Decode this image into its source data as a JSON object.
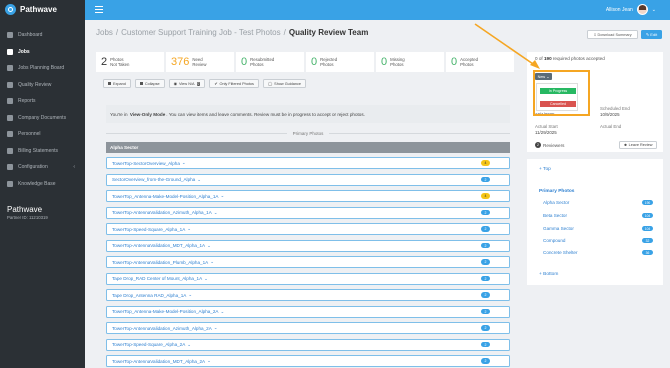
{
  "app": {
    "name": "Pathwave",
    "partner_id": "Partner ID: 11210319"
  },
  "sidebar": {
    "items": [
      {
        "label": "Dashboard",
        "icon": "dashboard-icon"
      },
      {
        "label": "Jobs",
        "icon": "tools-icon",
        "active": true
      },
      {
        "label": "Jobs Planning Board",
        "icon": "board-icon"
      },
      {
        "label": "Quality Review",
        "icon": "review-icon"
      },
      {
        "label": "Reports",
        "icon": "reports-icon"
      },
      {
        "label": "Company Documents",
        "icon": "documents-icon"
      },
      {
        "label": "Personnel",
        "icon": "people-icon"
      },
      {
        "label": "Billing Statements",
        "icon": "billing-icon"
      },
      {
        "label": "Configuration",
        "icon": "gear-icon",
        "caret": "‹"
      },
      {
        "label": "Knowledge Base",
        "icon": "help-icon"
      }
    ]
  },
  "topbar": {
    "user_name": "Allison Jean"
  },
  "breadcrumb": {
    "jobs": "Jobs",
    "job": "Customer Support Training Job - Test Photos",
    "current": "Quality Review Team"
  },
  "header_buttons": {
    "download": "Download Summary",
    "edit": "Edit"
  },
  "stats": [
    {
      "num": "2",
      "label1": "Photos",
      "label2": "Not Taken",
      "color": "default"
    },
    {
      "num": "376",
      "label1": "Need",
      "label2": "Review",
      "color": "orange"
    },
    {
      "num": "0",
      "label1": "Resubmitted",
      "label2": "Photos",
      "color": "green"
    },
    {
      "num": "0",
      "label1": "Rejected",
      "label2": "Photos",
      "color": "green"
    },
    {
      "num": "0",
      "label1": "Missing",
      "label2": "Photos",
      "color": "green"
    },
    {
      "num": "0",
      "label1": "Accepted",
      "label2": "Photos",
      "color": "green"
    }
  ],
  "toolbar": {
    "expand": "Expand",
    "collapse": "Collapse",
    "view_na": "View N/A",
    "view_na_badge": "0",
    "filtered": "Only Filtered Photos",
    "guidance": "Show Guidance"
  },
  "notice": {
    "pre": "You're in",
    "mode": "View-Only Mode",
    "post": ". You can view items and leave comments. Review must be in progress to accept or reject photos."
  },
  "primary_photos_label": "Primary Photos",
  "sector_header": "Alpha Sector",
  "rows": [
    {
      "label": "TowerTop-SectorOverview_Alpha",
      "count": "4",
      "color": "yellow"
    },
    {
      "label": "SectorOverview_from-the-Ground_Alpha",
      "count": "2",
      "color": "blue"
    },
    {
      "label": "TowerTop_Antenna-Make-Model-Position_Alpha_1A",
      "count": "4",
      "color": "yellow"
    },
    {
      "label": "TowerTop-AntennaValidation_Azimuth_Alpha_1A",
      "count": "2",
      "color": "blue"
    },
    {
      "label": "TowerTop-Speed-Square_Alpha_1A",
      "count": "2",
      "color": "blue"
    },
    {
      "label": "TowerTop-AntennaValidation_MDT_Alpha_1A",
      "count": "2",
      "color": "blue"
    },
    {
      "label": "TowerTop-AntennaValidation_Plumb_Alpha_1A",
      "count": "2",
      "color": "blue"
    },
    {
      "label": "Tape Drop_RAD Center of Mount_Alpha_1A",
      "count": "2",
      "color": "blue"
    },
    {
      "label": "Tape Drop_Antenna RAD_Alpha_1A",
      "count": "2",
      "color": "blue"
    },
    {
      "label": "TowerTop_Antenna-Make-Model-Position_Alpha_2A",
      "count": "2",
      "color": "blue"
    },
    {
      "label": "TowerTop-AntennaValidation_Azimuth_Alpha_2A",
      "count": "2",
      "color": "blue"
    },
    {
      "label": "TowerTop-Speed-Square_Alpha_2A",
      "count": "2",
      "color": "blue"
    },
    {
      "label": "TowerTop-AntennaValidation_MDT_Alpha_2A",
      "count": "2",
      "color": "blue"
    }
  ],
  "status_panel": {
    "progress_pre": "0 of",
    "progress_total": "190",
    "progress_post": "required photos accepted",
    "status_button": "New ⌄",
    "in_progress": "In Progress",
    "cancelled": "Cancelled",
    "start_date": "10/1/2025",
    "scheduled_end_label": "Scheduled End",
    "scheduled_end": "10/9/2025",
    "actual_start_label": "Actual Start",
    "actual_start": "11/29/2025",
    "actual_end_label": "Actual End",
    "reviewers_count": "2",
    "reviewers_label": "Reviewers",
    "leave_review": "Leave Review"
  },
  "nav_panel": {
    "top": "+ Top",
    "title": "Primary Photos",
    "items": [
      {
        "label": "Alpha Sector",
        "count": "190"
      },
      {
        "label": "Beta Sector",
        "count": "104"
      },
      {
        "label": "Gamma Sector",
        "count": "104"
      },
      {
        "label": "Compound",
        "count": "32"
      },
      {
        "label": "Concrete Shelter",
        "count": "36"
      }
    ],
    "bottom": "+ Bottom"
  },
  "colors": {
    "accent": "#39a2e6",
    "sidebar": "#2b3035",
    "highlight": "#f5a623",
    "green": "#27b862",
    "red": "#d9534f"
  }
}
